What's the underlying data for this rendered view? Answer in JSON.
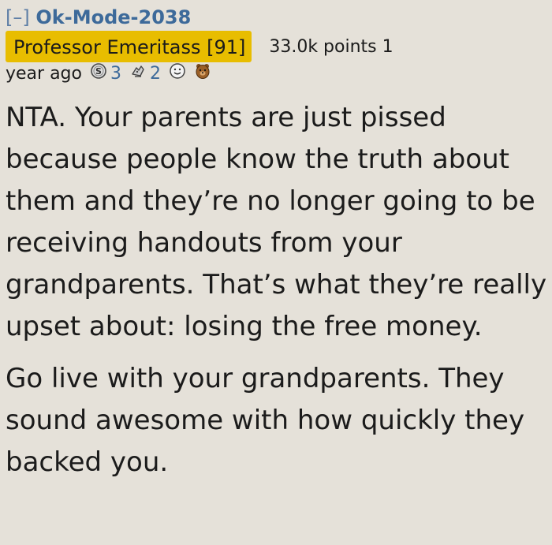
{
  "comment": {
    "collapse_toggle": "[–]",
    "author": "Ok-Mode-2038",
    "flair": "Professor Emeritass [91]",
    "points": "33.0k points 1",
    "time": "year ago",
    "awards": [
      {
        "icon": "silver-award-icon",
        "count": "3"
      },
      {
        "icon": "helpful-award-icon",
        "count": "2"
      },
      {
        "icon": "wholesome-award-icon",
        "count": ""
      },
      {
        "icon": "bear-award-icon",
        "count": ""
      }
    ],
    "paragraphs": [
      "NTA. Your parents are just pissed because people know the truth about them and they’re no longer going to be receiving handouts from your grandparents. That’s what they’re really upset about: losing the free money.",
      "Go live with your grandparents. They sound awesome with how quickly they backed you."
    ]
  },
  "colors": {
    "background": "#e5e1d9",
    "author_link": "#3d6a9a",
    "flair_bg": "#e8bd00"
  }
}
